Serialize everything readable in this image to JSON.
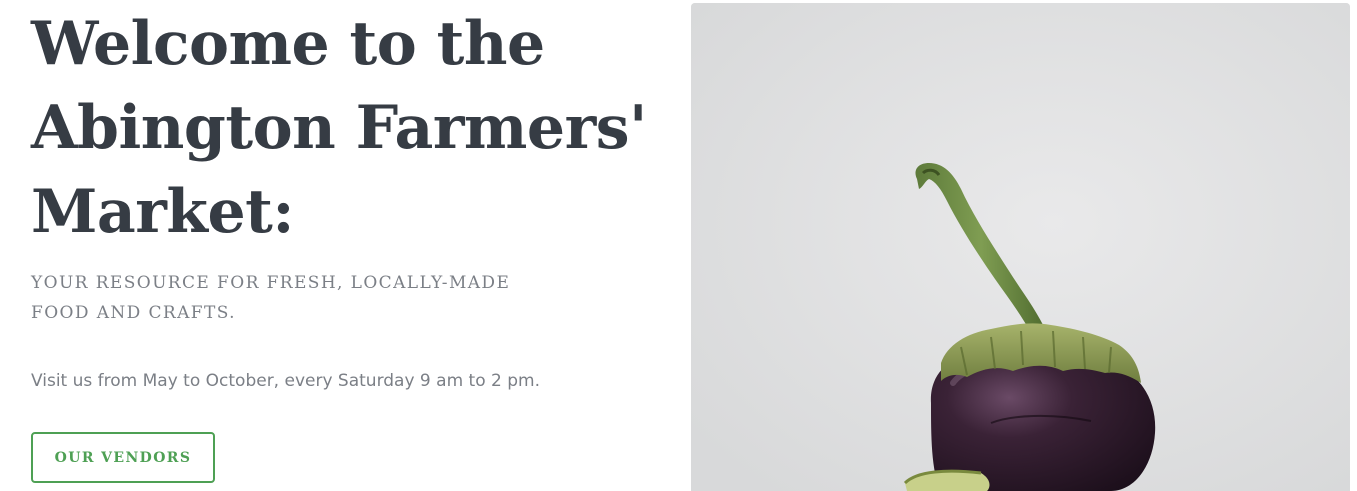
{
  "hero": {
    "title_lines": [
      "Welcome to the",
      "Abington Farmers'",
      "Market:"
    ],
    "subtitle_lines": [
      "YOUR RESOURCE FOR FRESH, LOCALLY-MADE",
      "FOOD AND CRAFTS."
    ],
    "hours": "Visit us from May to October, every Saturday 9 am to 2 pm.",
    "cta_label": "OUR VENDORS"
  },
  "image": {
    "subject": "eggplant-photo",
    "background_color": "#e1e2e3"
  },
  "colors": {
    "heading": "#363c44",
    "body_text": "#7b7f86",
    "accent_green": "#4ea054"
  }
}
